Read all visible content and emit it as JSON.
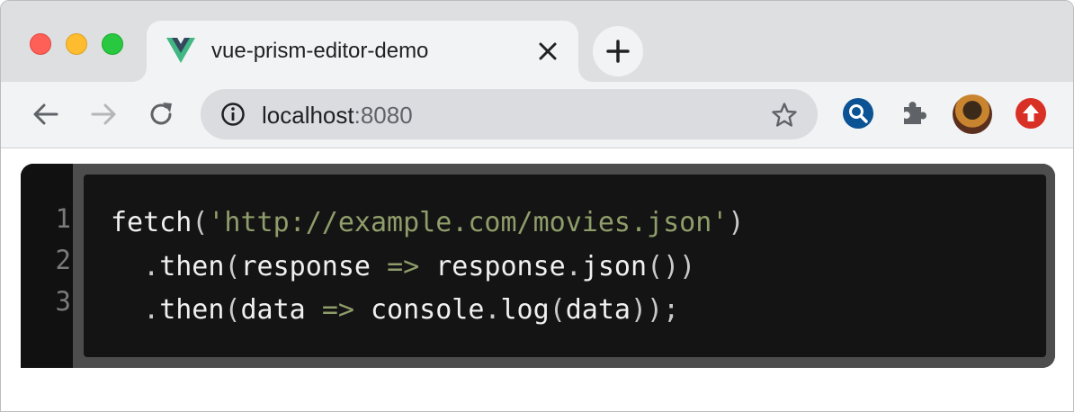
{
  "window": {
    "traffic_lights": [
      "close",
      "minimize",
      "zoom"
    ],
    "colors": {
      "close": "#fe5f57",
      "minimize": "#febc2e",
      "zoom": "#28c840"
    }
  },
  "tab": {
    "title": "vue-prism-editor-demo",
    "favicon": "vue-logo-icon"
  },
  "toolbar": {
    "back": "back-arrow-icon",
    "forward": "forward-arrow-icon",
    "reload": "reload-icon",
    "url_host": "localhost",
    "url_port": ":8080",
    "extensions": [
      "search-extension-icon",
      "extensions-puzzle-icon",
      "profile-avatar",
      "update-icon"
    ]
  },
  "editor": {
    "line_numbers": [
      "1",
      "2",
      "3"
    ],
    "lines": [
      [
        {
          "t": "fetch",
          "c": "plain"
        },
        {
          "t": "(",
          "c": "punc"
        },
        {
          "t": "'http://example.com/movies.json'",
          "c": "str"
        },
        {
          "t": ")",
          "c": "punc"
        }
      ],
      [
        {
          "t": "  ",
          "c": "plain"
        },
        {
          "t": ".",
          "c": "punc"
        },
        {
          "t": "then",
          "c": "plain"
        },
        {
          "t": "(",
          "c": "punc"
        },
        {
          "t": "response ",
          "c": "plain"
        },
        {
          "t": "=>",
          "c": "op"
        },
        {
          "t": " response",
          "c": "plain"
        },
        {
          "t": ".",
          "c": "punc"
        },
        {
          "t": "json",
          "c": "plain"
        },
        {
          "t": "())",
          "c": "punc"
        }
      ],
      [
        {
          "t": "  ",
          "c": "plain"
        },
        {
          "t": ".",
          "c": "punc"
        },
        {
          "t": "then",
          "c": "plain"
        },
        {
          "t": "(",
          "c": "punc"
        },
        {
          "t": "data ",
          "c": "plain"
        },
        {
          "t": "=>",
          "c": "op"
        },
        {
          "t": " console",
          "c": "plain"
        },
        {
          "t": ".",
          "c": "punc"
        },
        {
          "t": "log",
          "c": "plain"
        },
        {
          "t": "(",
          "c": "punc"
        },
        {
          "t": "data",
          "c": "plain"
        },
        {
          "t": "));",
          "c": "punc"
        }
      ]
    ],
    "colors": {
      "string": "#8f9d6a",
      "operator": "#8f9d6a",
      "text": "#f0f0f0",
      "background": "#141414"
    }
  }
}
